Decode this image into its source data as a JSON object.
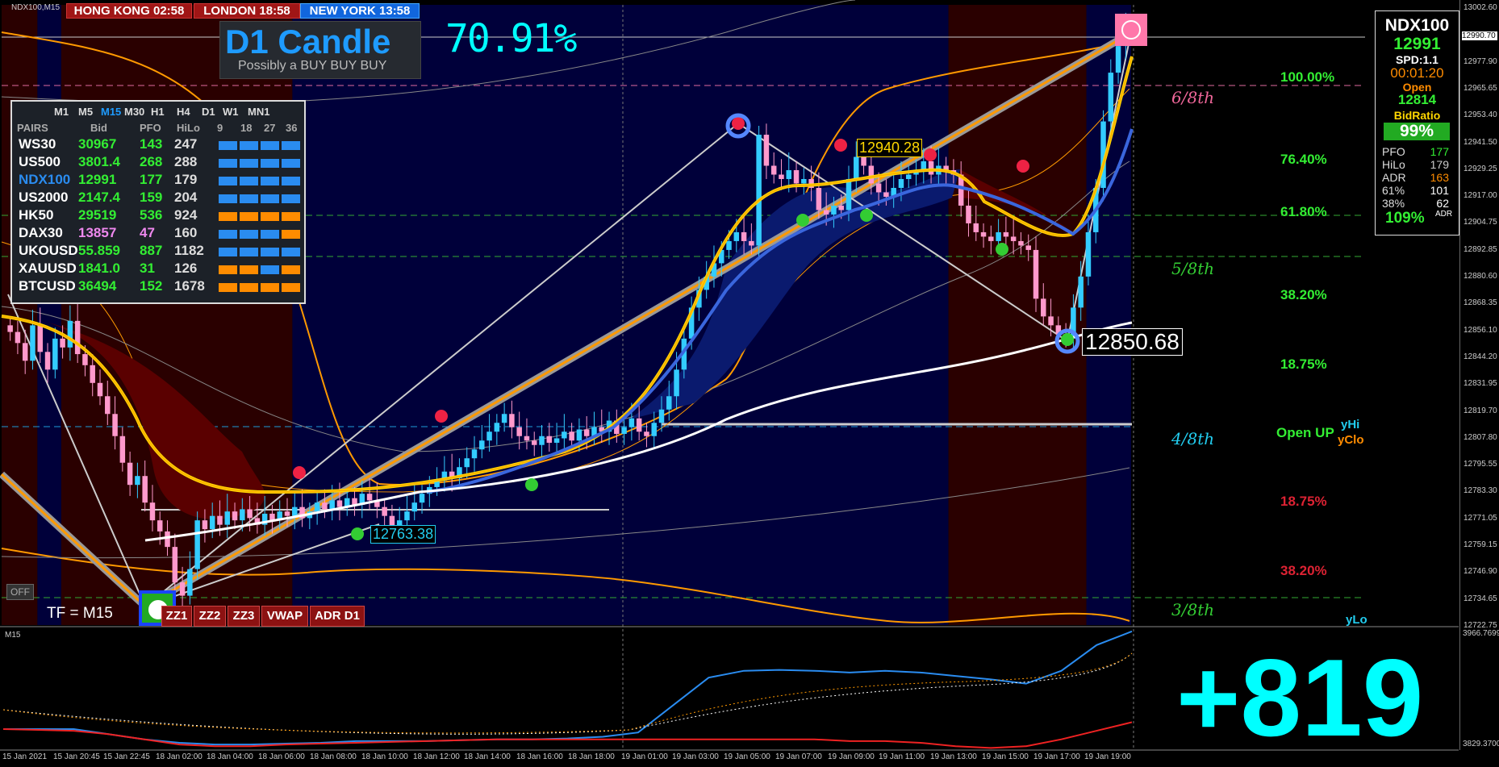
{
  "chart_title": "NDX100,M15",
  "clocks": [
    {
      "label": "HONG KONG 02:58",
      "style": "red"
    },
    {
      "label": "LONDON  18:58",
      "style": "red"
    },
    {
      "label": "NEW YORK  13:58",
      "style": "blue"
    }
  ],
  "logo": {
    "title": "D1 Candle",
    "subtitle": "Possibly a BUY BUY BUY"
  },
  "percentage": "70.91%",
  "panel": {
    "timeframes": [
      "M1",
      "M5",
      "M15",
      "M30",
      "H1",
      "H4",
      "D1",
      "W1",
      "MN1"
    ],
    "active_timeframe": "M15",
    "headers": [
      "PAIRS",
      "Bid",
      "PFO",
      "HiLo",
      "9",
      "18",
      "27",
      "36"
    ],
    "rows": [
      {
        "pair": "WS30",
        "bid": "30967",
        "pfo": "143",
        "hilo": "247",
        "pair_color": "#ffffff",
        "bid_color": "#33ee33",
        "pfo_color": "#33ee33",
        "bars": [
          "#2a8cf0",
          "#2a8cf0",
          "#2a8cf0",
          "#2a8cf0"
        ]
      },
      {
        "pair": "US500",
        "bid": "3801.4",
        "pfo": "268",
        "hilo": "288",
        "pair_color": "#ffffff",
        "bid_color": "#33ee33",
        "pfo_color": "#33ee33",
        "bars": [
          "#2a8cf0",
          "#2a8cf0",
          "#2a8cf0",
          "#2a8cf0"
        ]
      },
      {
        "pair": "NDX100",
        "bid": "12991",
        "pfo": "177",
        "hilo": "179",
        "pair_color": "#2a8cf0",
        "bid_color": "#33ee33",
        "pfo_color": "#33ee33",
        "bars": [
          "#2a8cf0",
          "#2a8cf0",
          "#2a8cf0",
          "#2a8cf0"
        ]
      },
      {
        "pair": "US2000",
        "bid": "2147.4",
        "pfo": "159",
        "hilo": "204",
        "pair_color": "#ffffff",
        "bid_color": "#33ee33",
        "pfo_color": "#33ee33",
        "bars": [
          "#2a8cf0",
          "#2a8cf0",
          "#2a8cf0",
          "#2a8cf0"
        ]
      },
      {
        "pair": "HK50",
        "bid": "29519",
        "pfo": "536",
        "hilo": "924",
        "pair_color": "#ffffff",
        "bid_color": "#33ee33",
        "pfo_color": "#33ee33",
        "bars": [
          "#ff8c00",
          "#ff8c00",
          "#ff8c00",
          "#ff8c00"
        ]
      },
      {
        "pair": "DAX30",
        "bid": "13857",
        "pfo": "47",
        "hilo": "160",
        "pair_color": "#ffffff",
        "bid_color": "#ee88ee",
        "pfo_color": "#ee88ee",
        "bars": [
          "#2a8cf0",
          "#2a8cf0",
          "#2a8cf0",
          "#ff8c00"
        ]
      },
      {
        "pair": "UKOUSD",
        "bid": "55.859",
        "pfo": "887",
        "hilo": "1182",
        "pair_color": "#ffffff",
        "bid_color": "#33ee33",
        "pfo_color": "#33ee33",
        "bars": [
          "#2a8cf0",
          "#2a8cf0",
          "#2a8cf0",
          "#2a8cf0"
        ]
      },
      {
        "pair": "XAUUSD",
        "bid": "1841.0",
        "pfo": "31",
        "hilo": "126",
        "pair_color": "#ffffff",
        "bid_color": "#33ee33",
        "pfo_color": "#33ee33",
        "bars": [
          "#ff8c00",
          "#ff8c00",
          "#2a8cf0",
          "#ff8c00"
        ]
      },
      {
        "pair": "BTCUSD",
        "bid": "36494",
        "pfo": "152",
        "hilo": "1678",
        "pair_color": "#ffffff",
        "bid_color": "#33ee33",
        "pfo_color": "#33ee33",
        "bars": [
          "#ff8c00",
          "#ff8c00",
          "#ff8c00",
          "#ff8c00"
        ]
      }
    ]
  },
  "right_box": {
    "symbol": "NDX100",
    "price": "12991",
    "spread": "SPD:1.1",
    "timer": "00:01:20",
    "open_label": "Open",
    "open_value": "12814",
    "bidratio_label": "BidRatio",
    "bidratio_value": "99%",
    "stats": [
      {
        "label": "PFO",
        "value": "177",
        "color": "#33ee33"
      },
      {
        "label": "HiLo",
        "value": "179",
        "color": "#cccccc"
      },
      {
        "label": "ADR",
        "value": "163",
        "color": "#ff8c00"
      },
      {
        "label": "61%",
        "value": "101",
        "color": "#ffffff"
      },
      {
        "label": "38%",
        "value": "62",
        "color": "#ffffff"
      }
    ],
    "adr_pct": "109%",
    "adr_suffix": "ADR"
  },
  "fib_levels": [
    {
      "label": "100.00%",
      "price": 12969,
      "color": "#33ee33"
    },
    {
      "label": "76.40%",
      "price": 12931,
      "color": "#33ee33"
    },
    {
      "label": "61.80%",
      "price": 12908,
      "color": "#33ee33"
    },
    {
      "label": "38.20%",
      "price": 12870,
      "color": "#33ee33"
    },
    {
      "label": "18.75%",
      "price": 12839,
      "color": "#33ee33"
    },
    {
      "label": "18.75%",
      "price": 12780,
      "color": "#dd2233"
    },
    {
      "label": "38.20%",
      "price": 12749,
      "color": "#dd2233"
    }
  ],
  "murrey": [
    {
      "label": "6/8th",
      "price": 12968,
      "color": "#ee6699"
    },
    {
      "label": "5/8th",
      "price": 12895,
      "color": "#33cc33"
    },
    {
      "label": "4/8th",
      "price": 12817,
      "color": "#22ccee"
    },
    {
      "label": "3/8th",
      "price": 12729,
      "color": "#33cc33"
    }
  ],
  "open_up_label": "Open UP",
  "yhi_label": "yHi",
  "yclo_label": "yClo",
  "ylo_label": "yLo",
  "price_labels": {
    "high": "12940.28",
    "low": "12763.38",
    "current": "12850.68",
    "current_axis": "12990.70"
  },
  "buttons": [
    "ZZ1",
    "ZZ2",
    "ZZ3",
    "VWAP",
    "ADR D1"
  ],
  "off_label": "OFF",
  "tf_label": "TF = M15",
  "sub_title": "M15",
  "big_number": "+819",
  "colors": {
    "bg": "#000000",
    "session_blue": "#00003a",
    "session_red": "#2a0000",
    "bull": "#33ccff",
    "bear": "#ff99cc",
    "accent_cyan": "#00ffff"
  },
  "price_axis": [
    "13002.60",
    "12990.70",
    "12977.90",
    "12965.65",
    "12953.40",
    "12941.50",
    "12929.25",
    "12917.00",
    "12904.75",
    "12892.85",
    "12880.60",
    "12868.35",
    "12856.10",
    "12844.20",
    "12831.95",
    "12819.70",
    "12807.80",
    "12795.55",
    "12783.30",
    "12771.05",
    "12759.15",
    "12746.90",
    "12734.65",
    "12722.75"
  ],
  "sub_axis": {
    "top": "3966.7699",
    "bottom": "3829.3700"
  },
  "time_axis": [
    "15 Jan 2021",
    "15 Jan 20:45",
    "15 Jan 22:45",
    "18 Jan 02:00",
    "18 Jan 04:00",
    "18 Jan 06:00",
    "18 Jan 08:00",
    "18 Jan 10:00",
    "18 Jan 12:00",
    "18 Jan 14:00",
    "18 Jan 16:00",
    "18 Jan 18:00",
    "19 Jan 01:00",
    "19 Jan 03:00",
    "19 Jan 05:00",
    "19 Jan 07:00",
    "19 Jan 09:00",
    "19 Jan 11:00",
    "19 Jan 13:00",
    "19 Jan 15:00",
    "19 Jan 17:00",
    "19 Jan 19:00"
  ],
  "chart_data": {
    "type": "candlestick",
    "symbol": "NDX100",
    "timeframe": "M15",
    "ylim": [
      12722.75,
      13002.6
    ],
    "sessions": [
      {
        "from": 0,
        "to": 0.048,
        "color": "red"
      },
      {
        "from": 0.048,
        "to": 0.08,
        "color": "blue"
      },
      {
        "from": 0.08,
        "to": 0.39,
        "color": "red"
      },
      {
        "from": 0.39,
        "to": 1.27,
        "color": "blue"
      },
      {
        "from": 1.27,
        "to": 1.455,
        "color": "red"
      },
      {
        "from": 1.455,
        "to": 1.515,
        "color": "blue"
      }
    ],
    "close": [
      12855,
      12850,
      12842,
      12858,
      12846,
      12838,
      12852,
      12848,
      12860,
      12845,
      12840,
      12832,
      12826,
      12818,
      12808,
      12796,
      12786,
      12790,
      12778,
      12770,
      12765,
      12758,
      12742,
      12736,
      12748,
      12770,
      12766,
      12772,
      12768,
      12774,
      12770,
      12775,
      12771,
      12768,
      12773,
      12770,
      12774,
      12772,
      12776,
      12771,
      12774,
      12778,
      12775,
      12779,
      12776,
      12780,
      12777,
      12782,
      12779,
      12776,
      12772,
      12767,
      12770,
      12774,
      12778,
      12782,
      12785,
      12788,
      12792,
      12789,
      12794,
      12798,
      12802,
      12806,
      12810,
      12814,
      12818,
      12812,
      12808,
      12806,
      12804,
      12808,
      12805,
      12807,
      12810,
      12806,
      12811,
      12808,
      12812,
      12810,
      12815,
      12809,
      12812,
      12816,
      12810,
      12808,
      12814,
      12820,
      12826,
      12838,
      12852,
      12866,
      12874,
      12880,
      12886,
      12892,
      12896,
      12900,
      12896,
      12894,
      12944,
      12930,
      12926,
      12924,
      12928,
      12922,
      12924,
      12920,
      12910,
      12908,
      12912,
      12910,
      12924,
      12934,
      12930,
      12922,
      12918,
      12916,
      12920,
      12924,
      12926,
      12928,
      12932,
      12926,
      12930,
      12928,
      12926,
      12912,
      12904,
      12900,
      12898,
      12896,
      12900,
      12898,
      12896,
      12894,
      12892,
      12870,
      12862,
      12858,
      12854,
      12852,
      12866,
      12880,
      12900,
      12920,
      12950,
      12972,
      12984,
      12991
    ],
    "ma_yellow": [
      12850,
      12850,
      12849,
      12848,
      12846,
      12844,
      12842,
      12840,
      12836,
      12830,
      12822,
      12812,
      12800,
      12792,
      12786,
      12782,
      12778,
      12775,
      12774,
      12773,
      12772,
      12772,
      12773,
      12774,
      12775,
      12776,
      12777,
      12778,
      12779,
      12780,
      12781,
      12782,
      12783,
      12784,
      12785,
      12786,
      12787,
      12788,
      12789,
      12790,
      12792,
      12794,
      12796,
      12798,
      12800,
      12803,
      12806,
      12810,
      12815,
      12822,
      12832,
      12846,
      12864,
      12880,
      12894,
      12904,
      12910,
      12914,
      12918,
      12920,
      12920,
      12918,
      12916,
      12918,
      12922,
      12924,
      12926,
      12924,
      12920,
      12912,
      12904,
      12900,
      12896,
      12890,
      12870,
      12880,
      12910,
      12940,
      12975
    ],
    "ma_white": [
      12770,
      12768,
      12767,
      12766,
      12766,
      12767,
      12768,
      12769,
      12770,
      12771,
      12772,
      12773,
      12774,
      12775,
      12776,
      12778,
      12780,
      12782,
      12784,
      12786,
      12789,
      12792,
      12796,
      12800,
      12804,
      12808,
      12812,
      12816,
      12820,
      12824,
      12828,
      12832,
      12836,
      12840,
      12844,
      12848,
      12850,
      12852,
      12856
    ],
    "zigzag": [
      [
        0.01,
        12870
      ],
      [
        0.095,
        12735
      ],
      [
        0.495,
        12942
      ],
      [
        0.715,
        12850
      ],
      [
        0.76,
        12985
      ]
    ],
    "markers": {
      "high_label": {
        "x": 0.57,
        "y": 12940.28
      },
      "low_label": {
        "x": 0.255,
        "y": 12763.38
      },
      "current_label": {
        "x": 0.76,
        "y": 12850.68
      }
    },
    "subwindow": {
      "series": [
        {
          "name": "blue",
          "values": [
            3852,
            3852,
            3852,
            3846,
            3840,
            3836,
            3834,
            3834,
            3835,
            3836,
            3838,
            3838,
            3838,
            3839,
            3840,
            3840,
            3841,
            3843,
            3848,
            3880,
            3912,
            3920,
            3921,
            3920,
            3918,
            3920,
            3918,
            3914,
            3910,
            3905,
            3920,
            3950,
            3966
          ]
        },
        {
          "name": "red",
          "values": [
            3852,
            3851,
            3850,
            3846,
            3840,
            3834,
            3832,
            3832,
            3834,
            3835,
            3836,
            3837,
            3838,
            3839,
            3840,
            3840,
            3840,
            3840,
            3840,
            3840,
            3840,
            3840,
            3840,
            3840,
            3838,
            3838,
            3836,
            3832,
            3830,
            3832,
            3840,
            3850,
            3860
          ]
        }
      ],
      "ylim": [
        3829.37,
        3966.77
      ]
    }
  }
}
